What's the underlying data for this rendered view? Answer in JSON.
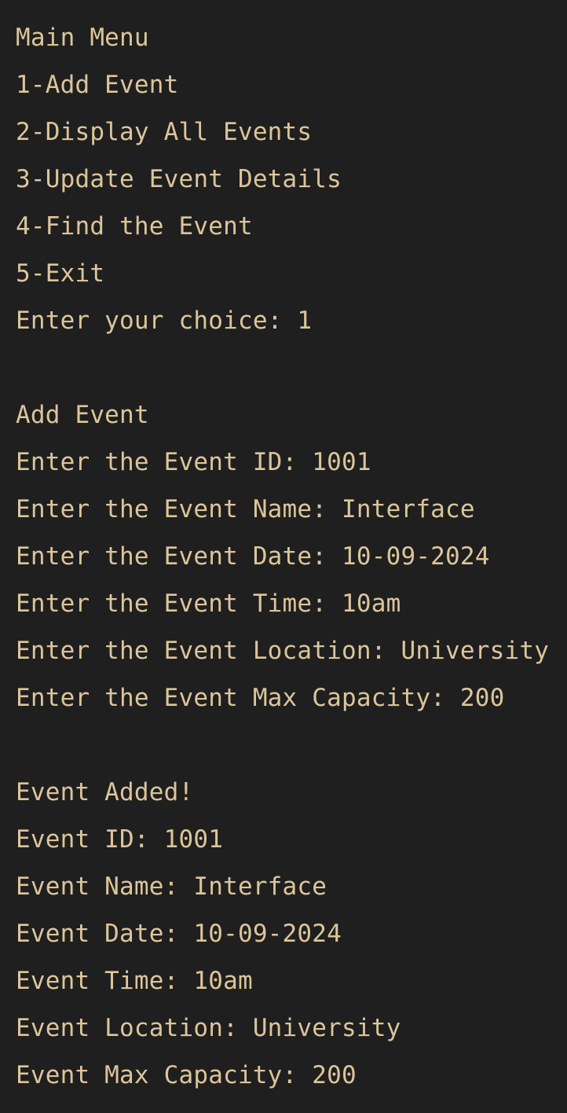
{
  "colors": {
    "background": "#1f1f1f",
    "text": "#dcc59a"
  },
  "menu": {
    "title": "Main Menu",
    "items": [
      "1-Add Event",
      "2-Display All Events",
      "3-Update Event Details",
      "4-Find the Event",
      "5-Exit"
    ],
    "prompt": "Enter your choice: 1"
  },
  "add_event": {
    "title": "Add Event",
    "prompts": [
      "Enter the Event ID: 1001",
      "Enter the Event Name: Interface",
      "Enter the Event Date: 10-09-2024",
      "Enter the Event Time: 10am",
      "Enter the Event Location: University",
      "Enter the Event Max Capacity: 200"
    ]
  },
  "result": {
    "title": "Event Added!",
    "details": [
      "Event ID: 1001",
      "Event Name: Interface",
      "Event Date: 10-09-2024",
      "Event Time: 10am",
      "Event Location: University",
      "Event Max Capacity: 200"
    ]
  }
}
